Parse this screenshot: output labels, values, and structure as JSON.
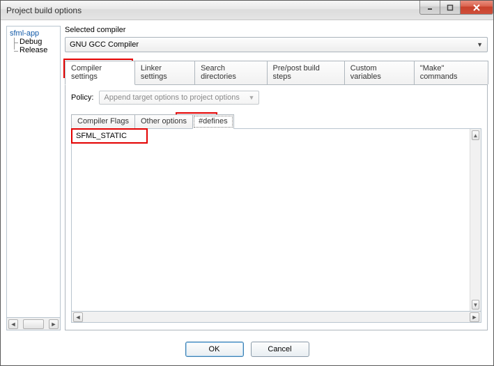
{
  "window": {
    "title": "Project build options"
  },
  "tree": {
    "root": "sfml-app",
    "children": [
      "Debug",
      "Release"
    ]
  },
  "compiler": {
    "label": "Selected compiler",
    "value": "GNU GCC Compiler"
  },
  "tabs": {
    "items": [
      "Compiler settings",
      "Linker settings",
      "Search directories",
      "Pre/post build steps",
      "Custom variables",
      "\"Make\" commands"
    ],
    "active_index": 0
  },
  "policy": {
    "label": "Policy:",
    "value": "Append target options to project options"
  },
  "subtabs": {
    "items": [
      "Compiler Flags",
      "Other options",
      "#defines"
    ],
    "active_index": 2
  },
  "defines": {
    "text": "SFML_STATIC"
  },
  "buttons": {
    "ok": "OK",
    "cancel": "Cancel"
  },
  "colors": {
    "highlight": "#e30000"
  }
}
